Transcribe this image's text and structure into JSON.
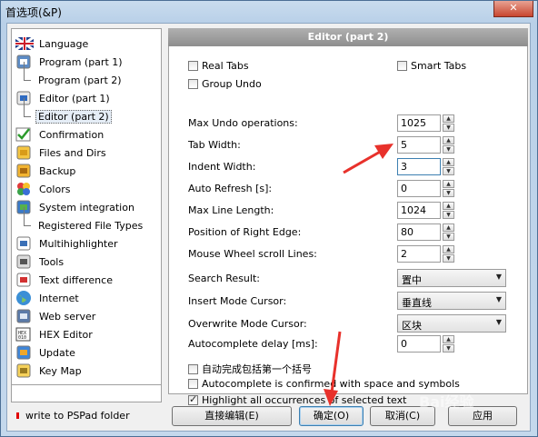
{
  "window": {
    "title": "首选项(&P)",
    "close_glyph": "✕"
  },
  "tree": {
    "items": [
      {
        "label": "Language",
        "icon": "flag-uk-icon",
        "level": 0
      },
      {
        "label": "Program  (part 1)",
        "icon": "program-window-icon",
        "level": 0
      },
      {
        "label": "Program  (part 2)",
        "icon": "",
        "level": 1
      },
      {
        "label": "Editor  (part 1)",
        "icon": "editor-pencil-icon",
        "level": 0
      },
      {
        "label": "Editor  (part 2)",
        "icon": "",
        "level": 1,
        "selected": true
      },
      {
        "label": "Confirmation",
        "icon": "confirmation-check-icon",
        "level": 0
      },
      {
        "label": "Files and Dirs",
        "icon": "folder-icon",
        "level": 0
      },
      {
        "label": "Backup",
        "icon": "backup-icon",
        "level": 0
      },
      {
        "label": "Colors",
        "icon": "colors-icon",
        "level": 0
      },
      {
        "label": "System integration",
        "icon": "system-integration-icon",
        "level": 0
      },
      {
        "label": "Registered File Types",
        "icon": "",
        "level": 1
      },
      {
        "label": "Multihighlighter",
        "icon": "multihighlighter-icon",
        "level": 0
      },
      {
        "label": "Tools",
        "icon": "tools-icon",
        "level": 0
      },
      {
        "label": "Text difference",
        "icon": "text-difference-icon",
        "level": 0
      },
      {
        "label": "Internet",
        "icon": "globe-icon",
        "level": 0
      },
      {
        "label": "Web server",
        "icon": "web-server-icon",
        "level": 0
      },
      {
        "label": "HEX Editor",
        "icon": "hex-editor-icon",
        "level": 0
      },
      {
        "label": "Update",
        "icon": "update-icon",
        "level": 0
      },
      {
        "label": "Key Map",
        "icon": "keymap-icon",
        "level": 0
      }
    ]
  },
  "footer_note": "write to PSPad folder",
  "panel": {
    "header": "Editor  (part 2)",
    "real_tabs": {
      "label": "Real Tabs",
      "checked": false
    },
    "smart_tabs": {
      "label": "Smart Tabs",
      "checked": false
    },
    "group_undo": {
      "label": "Group Undo",
      "checked": false
    },
    "fields": [
      {
        "label": "Max Undo operations:",
        "value": "1025"
      },
      {
        "label": "Tab Width:",
        "value": "5"
      },
      {
        "label": "Indent Width:",
        "value": "3"
      },
      {
        "label": "Auto Refresh [s]:",
        "value": "0"
      },
      {
        "label": "Max Line Length:",
        "value": "1024"
      },
      {
        "label": "Position of Right Edge:",
        "value": "80"
      },
      {
        "label": "Mouse Wheel scroll Lines:",
        "value": "2"
      }
    ],
    "selects": [
      {
        "label": "Search Result:",
        "value": "置中"
      },
      {
        "label": "Insert Mode Cursor:",
        "value": "垂直线"
      },
      {
        "label": "Overwrite Mode Cursor:",
        "value": "区块"
      }
    ],
    "autocomplete_delay": {
      "label": "Autocomplete delay [ms]:",
      "value": "0"
    },
    "checks": [
      {
        "label": "自动完成包括第一个括号",
        "checked": false
      },
      {
        "label": "Autocomplete is confirmed with space and symbols",
        "checked": false
      },
      {
        "label": "Highlight all occurrences of selected text",
        "checked": true
      }
    ]
  },
  "buttons": {
    "direct_edit": "直接编辑(E)",
    "ok": "确定(O)",
    "cancel": "取消(C)",
    "apply": "应用"
  },
  "watermark": "Bai经验",
  "colors": {
    "arrow": "#e8312b",
    "panel_header": "#9c9c9c"
  }
}
